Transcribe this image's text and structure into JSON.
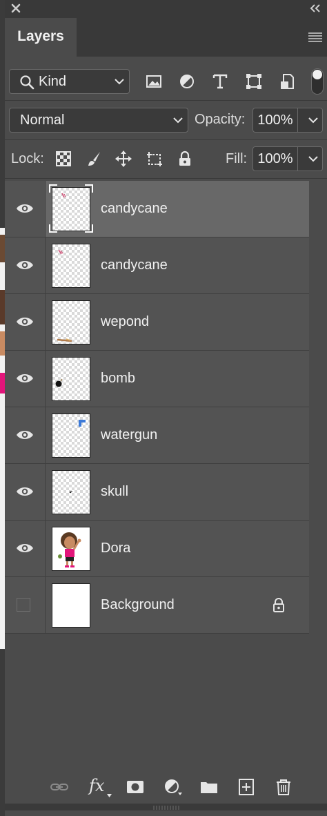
{
  "panel": {
    "tab_label": "Layers",
    "icons": {
      "close": "close-icon",
      "collapse": "double-chevron-left-icon",
      "menu": "panel-menu-icon"
    }
  },
  "filter": {
    "kind_label": "Kind",
    "kind_icons": [
      "image-filter-icon",
      "adjustment-filter-icon",
      "type-filter-icon",
      "shape-filter-icon",
      "smart-object-filter-icon"
    ],
    "toggle_icon": "filter-toggle-icon"
  },
  "blend": {
    "mode": "Normal",
    "opacity_label": "Opacity:",
    "opacity_value": "100%"
  },
  "lock": {
    "label": "Lock:",
    "icons": [
      "lock-transparent-pixels-icon",
      "lock-image-pixels-icon",
      "lock-position-icon",
      "lock-artboard-icon",
      "lock-all-icon"
    ],
    "fill_label": "Fill:",
    "fill_value": "100%"
  },
  "layers": [
    {
      "name": "candycane",
      "visible": true,
      "selected": true,
      "locked": false
    },
    {
      "name": "candycane",
      "visible": true,
      "selected": false,
      "locked": false
    },
    {
      "name": "wepond",
      "visible": true,
      "selected": false,
      "locked": false
    },
    {
      "name": "bomb",
      "visible": true,
      "selected": false,
      "locked": false
    },
    {
      "name": "watergun",
      "visible": true,
      "selected": false,
      "locked": false
    },
    {
      "name": "skull",
      "visible": true,
      "selected": false,
      "locked": false
    },
    {
      "name": "Dora",
      "visible": true,
      "selected": false,
      "locked": false
    },
    {
      "name": "Background",
      "visible": false,
      "selected": false,
      "locked": true
    }
  ],
  "bottom_toolbar": {
    "fx_label": "fx",
    "icons": [
      "link-layers-icon",
      "layer-style-icon",
      "add-mask-icon",
      "new-adjustment-layer-icon",
      "new-group-icon",
      "new-layer-icon",
      "delete-layer-icon"
    ]
  },
  "colors": {
    "panel_bg": "#4b4b4b",
    "selected_row": "#686868",
    "row_bg": "#535353"
  }
}
